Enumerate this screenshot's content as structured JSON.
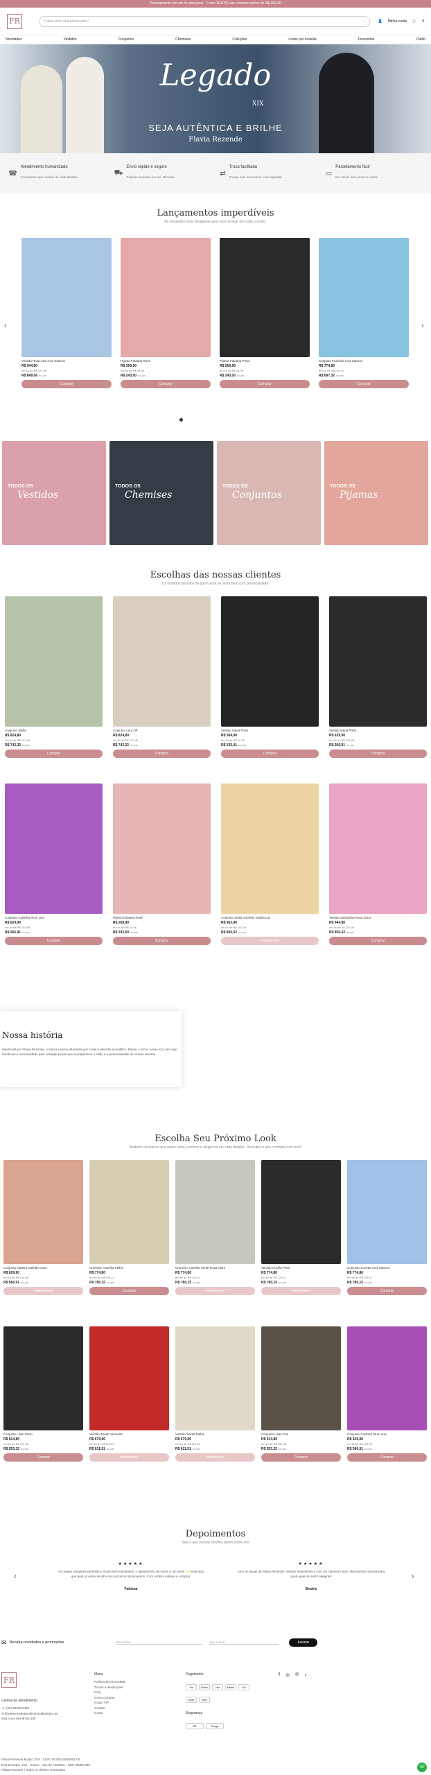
{
  "topbar": {
    "text": "Parcelamento em até 6x sem juros · Frete GRÁTIS nas compras acima de R$ 499,00"
  },
  "header": {
    "logo": "FR",
    "search_placeholder": "O que você está procurando?",
    "account_label": "Minha conta",
    "cart_count": "0"
  },
  "nav": [
    "Novidades",
    "Vestidos",
    "Conjuntos",
    "Chemises",
    "Coleções",
    "Looks por ocasião",
    "Descontos",
    "Outlet"
  ],
  "hero": {
    "title": "Legado",
    "roman": "XIX",
    "tagline": "SEJA AUTÊNTICA E BRILHE",
    "signature": "Flavia Rezende"
  },
  "features": [
    {
      "icon": "headset-icon",
      "title": "Atendimento humanizado",
      "text": "Consultoras que cuidam de cada detalhe"
    },
    {
      "icon": "truck-icon",
      "title": "Envio rápido e seguro",
      "text": "Pedidos enviados em até 48 horas"
    },
    {
      "icon": "exchange-icon",
      "title": "Troca facilitada",
      "text": "Troque sem burocracia, com agilidade"
    },
    {
      "icon": "card-icon",
      "title": "Parcelamento fácil",
      "text": "Em até 6x sem juros no cartão"
    }
  ],
  "launches": {
    "title": "Lançamentos imperdíveis",
    "subtitle": "As novidades mais desejadas para você arrasar em cada ocasião.",
    "products": [
      {
        "name": "Vestido Rosa Azul Azul Saturno",
        "price": "R$ 944,80",
        "installments": "em 6x de R$ 157,46",
        "pix": "R$ 849,06",
        "color": "#a9c6e4"
      },
      {
        "name": "Pijama Fabiana Rosé",
        "price": "R$ 269,90",
        "installments": "em 6x de R$ 44,98",
        "pix": "R$ 243,00",
        "color": "#e5a9a9"
      },
      {
        "name": "Pijama Fabiana Preto",
        "price": "R$ 269,90",
        "installments": "em 6x de R$ 44,98",
        "pix": "R$ 243,00",
        "color": "#2a2a2a"
      },
      {
        "name": "Conjunto Fruzinha Lina Saturno",
        "price": "R$ 774,80",
        "installments": "em 6x de R$ 129,13",
        "pix": "R$ 697,32",
        "color": "#88c3e0"
      }
    ],
    "button": "Comprar",
    "pix_suffix": "no pix"
  },
  "categories": [
    {
      "line1": "TODOS OS",
      "line2": "Vestidos",
      "color": "#dba1aa"
    },
    {
      "line1": "TODOS OS",
      "line2": "Chemises",
      "color": "#353c45"
    },
    {
      "line1": "TODOS OS",
      "line2": "Conjuntos",
      "color": "#d9b8b3"
    },
    {
      "line1": "TODOS OS",
      "line2": "Pijamas",
      "color": "#e2a69c"
    }
  ],
  "clients": {
    "title": "Escolhas das nossas clientes",
    "subtitle": "Os modelos favoritos de quem ama se vestir bem com personalidade.",
    "products": [
      {
        "name": "Conjunto Stella",
        "price": "R$ 824,80",
        "installments": "em 6x de R$ 137,46",
        "pix": "R$ 742,32",
        "color": "#b6c3a8",
        "btn": "Comprar",
        "dis": false
      },
      {
        "name": "Conjunto Lara Off",
        "price": "R$ 824,80",
        "installments": "em 6x de R$ 137,46",
        "pix": "R$ 742,32",
        "color": "#d9cfc1",
        "btn": "Comprar",
        "dis": false
      },
      {
        "name": "Vestido Iralda Preto",
        "price": "R$ 594,90",
        "installments": "em 6x de R$ 99,15",
        "pix": "R$ 535,41",
        "color": "#242424",
        "btn": "Comprar",
        "dis": false
      },
      {
        "name": "Vestido Iralda Preto",
        "price": "R$ 629,90",
        "installments": "em 6x de R$ 104,98",
        "pix": "R$ 566,91",
        "color": "#2b2b2b",
        "btn": "Comprar",
        "dis": false
      },
      {
        "name": "Conjunto Carlinha Plum Liss",
        "price": "R$ 629,90",
        "installments": "em 6x de R$ 104,98",
        "pix": "R$ 566,91",
        "color": "#a85bc1",
        "btn": "Comprar",
        "dis": false
      },
      {
        "name": "Pijama Fabiana Rosé",
        "price": "R$ 269,90",
        "installments": "em 6x de R$ 44,98",
        "pix": "R$ 243,00",
        "color": "#e7b5b5",
        "btn": "Comprar",
        "dis": false
      },
      {
        "name": "Conjunto Stella Amarelo Vanilla Lac",
        "price": "R$ 962,80",
        "installments": "em 6x de R$ 160,46",
        "pix": "R$ 866,52",
        "color": "#ecd5a0",
        "btn": "Indisponível",
        "dis": true
      },
      {
        "name": "Vestido Samantha Rosa Doce",
        "price": "R$ 944,80",
        "installments": "em 6x de R$ 157,46",
        "pix": "R$ 850,32",
        "color": "#eba5c4",
        "btn": "Comprar",
        "dis": false
      }
    ]
  },
  "story": {
    "title": "Nossa história",
    "text": "Idealizada por Flávia Rezende, a marca nasceu da paixão por moda e atenção ao público. Desde o início, nosso foco tem sido tendência e exclusividade para entregar peças que acompanham o estilo e a personalidade de nossas clientes."
  },
  "next_look": {
    "title": "Escolha Seu Próximo Look",
    "subtitle": "Modelos exclusivos que unem estilo, conforto e elegância em cada detalhe. Descubra o que combina com você!",
    "products": [
      {
        "name": "Conjunto Isadora Salmão Claro",
        "price": "R$ 629,90",
        "installments": "em 6x de R$ 104,98",
        "pix": "R$ 566,91",
        "color": "#d9a490",
        "btn": "Indisponível",
        "dis": true
      },
      {
        "name": "Chemise Camélia Palha",
        "price": "R$ 774,80",
        "installments": "em 6x de R$ 129,13",
        "pix": "R$ 780,15",
        "color": "#d5cdb2",
        "btn": "Comprar",
        "dis": false
      },
      {
        "name": "Chemise Camélia Verde Rosa Claro",
        "price": "R$ 774,80",
        "installments": "em 6x de R$ 129,13",
        "pix": "R$ 780,15",
        "color": "#c8c8c0",
        "btn": "Indisponível",
        "dis": true
      },
      {
        "name": "Vestido Cecília Preto",
        "price": "R$ 774,80",
        "installments": "em 6x de R$ 129,13",
        "pix": "R$ 780,15",
        "color": "#2a2a2a",
        "btn": "Indisponível",
        "dis": true
      },
      {
        "name": "Conjunto Sonetta Azul Saturno",
        "price": "R$ 774,80",
        "installments": "em 6x de R$ 129,13",
        "pix": "R$ 780,15",
        "color": "#9fc2e7",
        "btn": "Comprar",
        "dis": false
      },
      {
        "name": "Conjunto Lilian Preto",
        "price": "R$ 614,80",
        "installments": "em 6x de R$ 102,46",
        "pix": "R$ 553,32",
        "color": "#2b2b2b",
        "btn": "Comprar",
        "dis": false
      },
      {
        "name": "Vestido Tiarah Vermelho",
        "price": "R$ 679,90",
        "installments": "em 6x de R$ 113,31",
        "pix": "R$ 611,91",
        "color": "#c32a2a",
        "btn": "Indisponível",
        "dis": true
      },
      {
        "name": "Vestido Tiarah Palha",
        "price": "R$ 679,90",
        "installments": "em 6x de R$ 113,31",
        "pix": "R$ 611,91",
        "color": "#e0d9c9",
        "btn": "Indisponível",
        "dis": true
      },
      {
        "name": "Conjunto Lilian Poá",
        "price": "R$ 614,80",
        "installments": "em 6x de R$ 102,46",
        "pix": "R$ 553,32",
        "color": "#5b5248",
        "btn": "Comprar",
        "dis": false
      },
      {
        "name": "Conjunto Carlinha Plum Liss",
        "price": "R$ 629,90",
        "installments": "em 6x de R$ 104,98",
        "pix": "R$ 566,91",
        "color": "#a74fb6",
        "btn": "Comprar",
        "dis": false
      }
    ]
  },
  "testimonials": {
    "title": "Depoimentos",
    "subtitle": "Veja o que nossas clientes dizem sobre nós",
    "items": [
      {
        "stars": "★★★★★",
        "text": "As roupas chegaram perfeitas e muito bem embaladas, o atendimento de vocês é um show ✨ Amei tudo que pedi, já estou de olho nos próximos lançamentos. Com certeza voltarei a comprar.",
        "author": "Fabiana"
      },
      {
        "stars": "★★★★★",
        "text": "Amo as peças da Flávia Rezende, sempre impecáveis e com um caimento lindo. Recomendo demais para quem quer se sentir elegante!",
        "author": "Beatriz"
      }
    ]
  },
  "newsletter": {
    "label": "Receba novidades e promoções",
    "name_placeholder": "Seu nome",
    "email_placeholder": "Seu e-mail",
    "button": "Assinar"
  },
  "footer": {
    "contact_title": "Central de atendimento",
    "phone": "(32) 99468-5450",
    "email": "flaviarezendeatendimento@gmail.com",
    "hours": "Seg a sex das 9h às 18h",
    "menu_title": "Menu",
    "menu": [
      "Política de privacidade",
      "Trocas e devoluções",
      "FAQ",
      "Como comprar",
      "Grupo VIP",
      "Contato",
      "Conta"
    ],
    "payment_title": "Pagamento",
    "payments": [
      "Pix",
      "Boleto",
      "Visa",
      "Master",
      "Elo",
      "Amex",
      "Hiper"
    ],
    "security_title": "Segurança",
    "security": [
      "SSL",
      "Google"
    ],
    "company": "Flávia Rezende Moda LTDA · CNPJ 00.000.000/0001-00",
    "address": "Rua Exemplo, 123 · Centro · Juiz de Fora/MG · CEP 36000-000",
    "credits": "Flávia Rezende | Todos os direitos reservados"
  }
}
